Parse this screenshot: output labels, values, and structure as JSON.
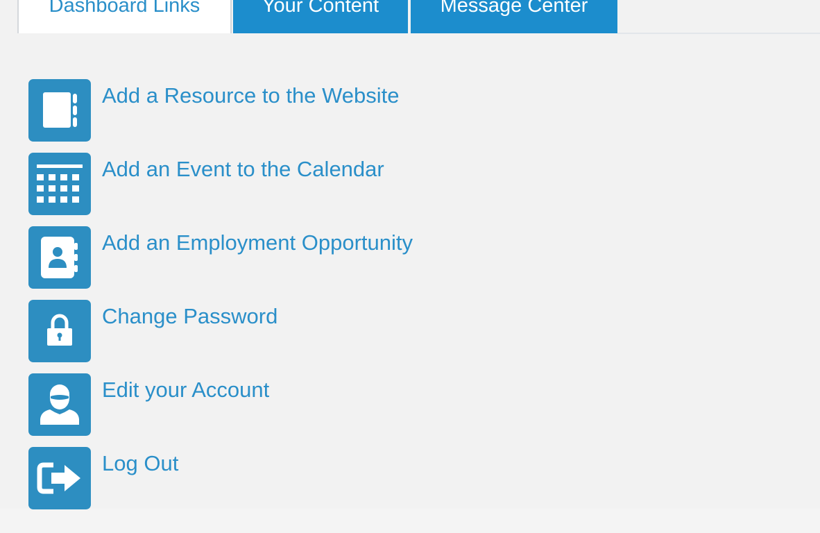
{
  "tabs": [
    {
      "label": "Dashboard Links",
      "active": true
    },
    {
      "label": "Your Content",
      "active": false
    },
    {
      "label": "Message Center",
      "active": false
    }
  ],
  "links": [
    {
      "label": "Add a Resource to the Website",
      "icon": "notebook-icon"
    },
    {
      "label": "Add an Event to the Calendar",
      "icon": "calendar-icon"
    },
    {
      "label": "Add an Employment Opportunity",
      "icon": "contact-book-icon"
    },
    {
      "label": "Change Password",
      "icon": "lock-icon"
    },
    {
      "label": "Edit your Account",
      "icon": "user-icon"
    },
    {
      "label": "Log Out",
      "icon": "sign-out-icon"
    }
  ],
  "colors": {
    "tab_active_text": "#2a8fc9",
    "tab_inactive_bg": "#1c8dcd",
    "icon_bg": "#2d8ec1",
    "link_text": "#2a8fc9",
    "panel_bg": "#f2f2f2"
  }
}
